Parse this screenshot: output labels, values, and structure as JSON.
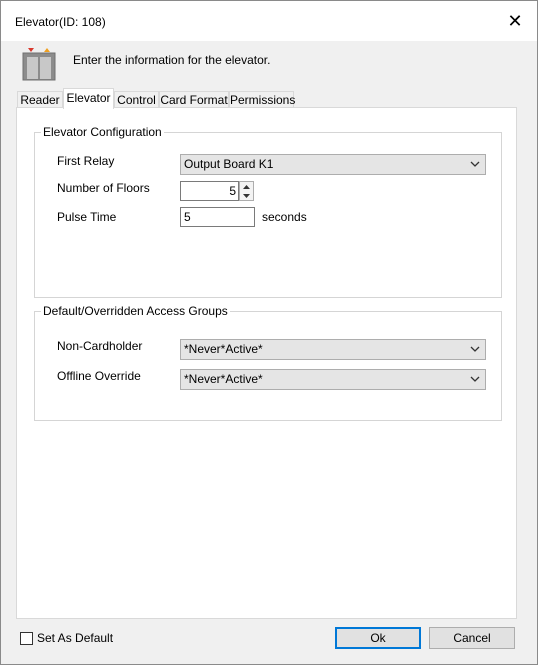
{
  "window": {
    "title": "Elevator(ID: 108)"
  },
  "header": {
    "text": "Enter the information for the elevator."
  },
  "tabs": [
    {
      "label": "Reader"
    },
    {
      "label": "Elevator"
    },
    {
      "label": "Control"
    },
    {
      "label": "Card Format"
    },
    {
      "label": "Permissions"
    }
  ],
  "elevator_config": {
    "legend": "Elevator Configuration",
    "first_relay_label": "First Relay",
    "first_relay_value": "Output Board K1",
    "num_floors_label": "Number of Floors",
    "num_floors_value": "5",
    "pulse_time_label": "Pulse Time",
    "pulse_time_value": "5",
    "pulse_time_unit": "seconds"
  },
  "access_groups": {
    "legend": "Default/Overridden Access Groups",
    "non_cardholder_label": "Non-Cardholder",
    "non_cardholder_value": "*Never*Active*",
    "offline_override_label": "Offline Override",
    "offline_override_value": "*Never*Active*"
  },
  "footer": {
    "set_default_label": "Set As Default",
    "ok_label": "Ok",
    "cancel_label": "Cancel"
  },
  "colors": {
    "accent": "#0078d7",
    "window_bg": "#f0f0f0",
    "panel_bg": "#ffffff"
  }
}
